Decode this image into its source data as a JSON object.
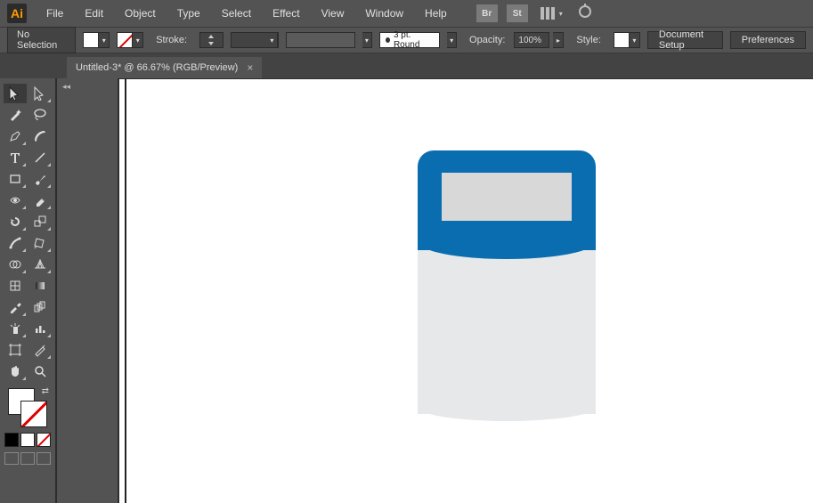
{
  "menu": {
    "file": "File",
    "edit": "Edit",
    "object": "Object",
    "type": "Type",
    "select": "Select",
    "effect": "Effect",
    "view": "View",
    "window": "Window",
    "help": "Help",
    "bridge_abbr": "Br",
    "stock_abbr": "St"
  },
  "control": {
    "no_selection": "No Selection",
    "stroke_label": "Stroke:",
    "round_point": "3 pt. Round",
    "opacity_label": "Opacity:",
    "opacity_value": "100%",
    "style_label": "Style:",
    "doc_setup": "Document Setup",
    "preferences": "Preferences"
  },
  "tab": {
    "title": "Untitled-3* @ 66.67% (RGB/Preview)",
    "close": "×"
  },
  "app_logo": "Ai"
}
